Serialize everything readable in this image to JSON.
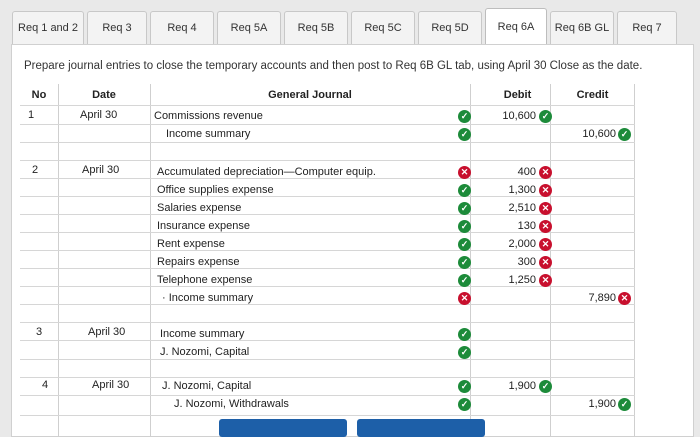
{
  "tabs": [
    "Req 1 and 2",
    "Req 3",
    "Req 4",
    "Req 5A",
    "Req 5B",
    "Req 5C",
    "Req 5D",
    "Req 6A",
    "Req 6B GL",
    "Req 7"
  ],
  "active_tab": "Req 6A",
  "instruction": "Prepare journal entries to close the temporary accounts and then post to Req 6B GL tab, using April 30 Close as the date.",
  "headers": {
    "no": "No",
    "date": "Date",
    "journal": "General Journal",
    "debit": "Debit",
    "credit": "Credit"
  },
  "rows": [
    {
      "no": "1",
      "date": "April 30",
      "account": "Commissions revenue",
      "debit": "10,600",
      "debit_status": "ok",
      "credit": "",
      "credit_status": "",
      "row_status": "ok"
    },
    {
      "no": "",
      "date": "",
      "account": "Income summary",
      "debit": "",
      "debit_status": "",
      "credit": "10,600",
      "credit_status": "ok",
      "row_status": "ok"
    },
    {
      "no": "2",
      "date": "April 30",
      "account": "Accumulated depreciation—Computer equip.",
      "debit": "400",
      "debit_status": "bad",
      "credit": "",
      "credit_status": "",
      "row_status": "bad"
    },
    {
      "no": "",
      "date": "",
      "account": "Office supplies expense",
      "debit": "1,300",
      "debit_status": "bad",
      "credit": "",
      "credit_status": "",
      "row_status": "ok"
    },
    {
      "no": "",
      "date": "",
      "account": "Salaries expense",
      "debit": "2,510",
      "debit_status": "bad",
      "credit": "",
      "credit_status": "",
      "row_status": "ok"
    },
    {
      "no": "",
      "date": "",
      "account": "Insurance expense",
      "debit": "130",
      "debit_status": "bad",
      "credit": "",
      "credit_status": "",
      "row_status": "ok"
    },
    {
      "no": "",
      "date": "",
      "account": "Rent expense",
      "debit": "2,000",
      "debit_status": "bad",
      "credit": "",
      "credit_status": "",
      "row_status": "ok"
    },
    {
      "no": "",
      "date": "",
      "account": "Repairs expense",
      "debit": "300",
      "debit_status": "bad",
      "credit": "",
      "credit_status": "",
      "row_status": "ok"
    },
    {
      "no": "",
      "date": "",
      "account": "Telephone expense",
      "debit": "1,250",
      "debit_status": "bad",
      "credit": "",
      "credit_status": "",
      "row_status": "ok"
    },
    {
      "no": "",
      "date": "",
      "account": "Income summary",
      "debit": "",
      "debit_status": "",
      "credit": "7,890",
      "credit_status": "bad",
      "row_status": "bad"
    },
    {
      "no": "3",
      "date": "April 30",
      "account": "Income summary",
      "debit": "",
      "debit_status": "",
      "credit": "",
      "credit_status": "",
      "row_status": "ok"
    },
    {
      "no": "",
      "date": "",
      "account": "J. Nozomi, Capital",
      "debit": "",
      "debit_status": "",
      "credit": "",
      "credit_status": "",
      "row_status": "ok"
    },
    {
      "no": "4",
      "date": "April 30",
      "account": "J. Nozomi, Capital",
      "debit": "1,900",
      "debit_status": "ok",
      "credit": "",
      "credit_status": "",
      "row_status": "ok"
    },
    {
      "no": "",
      "date": "",
      "account": "J. Nozomi, Withdrawals",
      "debit": "",
      "debit_status": "",
      "credit": "1,900",
      "credit_status": "ok",
      "row_status": "ok"
    }
  ],
  "colors": {
    "accent": "#1d5fa8",
    "ok": "#1d8b3a",
    "bad": "#c8102e"
  }
}
